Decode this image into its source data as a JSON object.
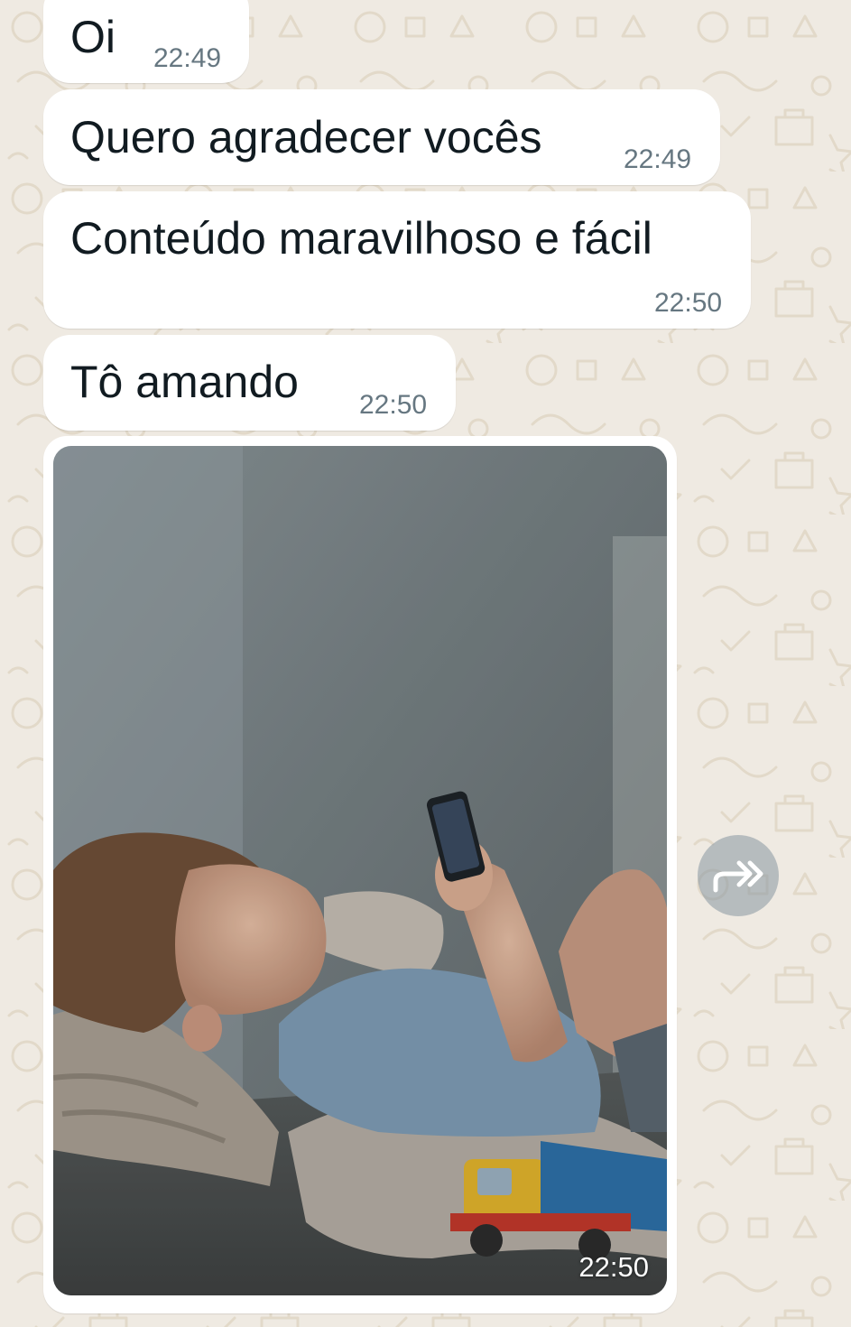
{
  "chat": {
    "messages": [
      {
        "text": "Oi",
        "time": "22:49"
      },
      {
        "text": "Quero agradecer vocês",
        "time": "22:49"
      },
      {
        "text": "Conteúdo maravilhoso e fácil",
        "time": "22:50"
      },
      {
        "text": "Tô amando",
        "time": "22:50"
      }
    ],
    "photo_message": {
      "time": "22:50",
      "image_subject": "child lying on a couch holding a smartphone, with a toy truck"
    },
    "forward_button_icon": "forward-arrow-icon"
  },
  "colors": {
    "chat_background": "#efeae2",
    "bubble": "#ffffff",
    "message_text": "#111b21",
    "timestamp": "#667781"
  }
}
